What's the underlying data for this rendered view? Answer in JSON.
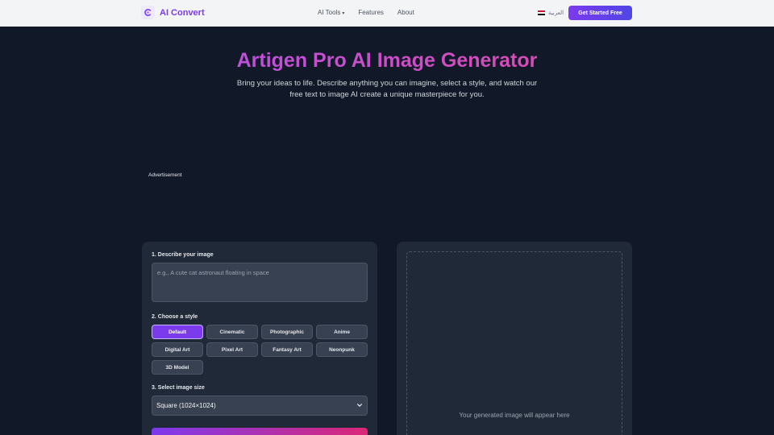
{
  "header": {
    "brand": "AI Convert",
    "nav": [
      {
        "label": "AI Tools",
        "has_dropdown": true
      },
      {
        "label": "Features"
      },
      {
        "label": "About"
      }
    ],
    "language": "العربية",
    "cta_label": "Get Started Free"
  },
  "hero": {
    "title": "Artigen Pro AI Image Generator",
    "subtitle": "Bring your ideas to life. Describe anything you can imagine, select a style, and watch our free text to image AI create a unique masterpiece for you."
  },
  "ad_label": "Advertisement",
  "form": {
    "describe_label": "1. Describe your image",
    "prompt_placeholder": "e.g., A cute cat astronaut floating in space",
    "prompt_value": "",
    "style_label": "2. Choose a style",
    "styles": [
      "Default",
      "Cinematic",
      "Photographic",
      "Anime",
      "Digital Art",
      "Pixel Art",
      "Fantasy Art",
      "Neonpunk",
      "3D Model"
    ],
    "selected_style": "Default",
    "size_label": "3. Select image size",
    "selected_size": "Square (1024×1024)"
  },
  "output": {
    "placeholder": "Your generated image will appear here"
  },
  "colors": {
    "accent": "#7c3aed",
    "accent_pink": "#ec4899",
    "background": "#111827",
    "panel": "#1f2937"
  }
}
